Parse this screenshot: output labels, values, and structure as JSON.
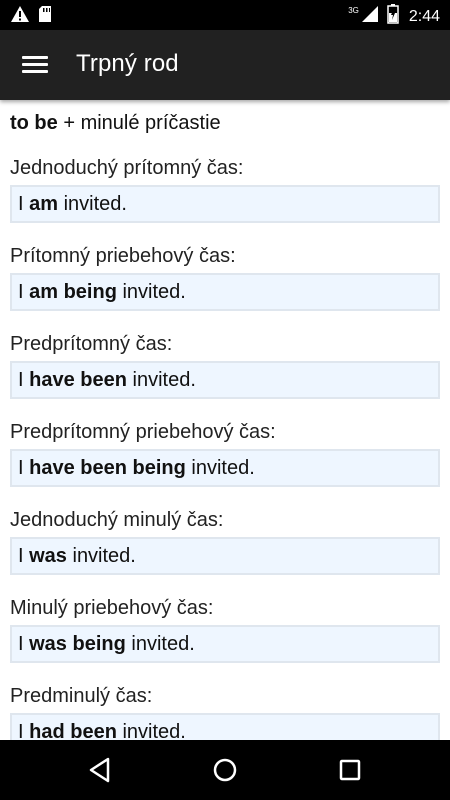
{
  "status_bar": {
    "time": "2:44",
    "network": "3G",
    "icons": [
      "warning-icon",
      "sd-card-icon",
      "signal-icon",
      "battery-icon"
    ]
  },
  "app_bar": {
    "title": "Trpný rod",
    "menu_icon": "hamburger-menu-icon"
  },
  "formula": {
    "strong": "to be",
    "rest": " + minulé príčastie"
  },
  "sections": [
    {
      "label": "Jednoduchý prítomný čas:",
      "pre": "I ",
      "strong": "am",
      "post": " invited."
    },
    {
      "label": "Prítomný priebehový čas:",
      "pre": "I ",
      "strong": "am being",
      "post": " invited."
    },
    {
      "label": "Predprítomný čas:",
      "pre": "I ",
      "strong": "have been",
      "post": " invited."
    },
    {
      "label": "Predprítomný priebehový čas:",
      "pre": "I ",
      "strong": "have been being",
      "post": " invited."
    },
    {
      "label": "Jednoduchý minulý čas:",
      "pre": "I ",
      "strong": "was",
      "post": " invited."
    },
    {
      "label": "Minulý priebehový čas:",
      "pre": "I ",
      "strong": "was being",
      "post": " invited."
    },
    {
      "label": "Predminulý čas:",
      "pre": "I ",
      "strong": "had been",
      "post": " invited."
    }
  ],
  "nav_bar": {
    "buttons": [
      "back-icon",
      "home-icon",
      "recents-icon"
    ]
  },
  "colors": {
    "app_bar": "#212121",
    "example_bg": "#eef6ff",
    "example_border": "#dfe6ee"
  }
}
